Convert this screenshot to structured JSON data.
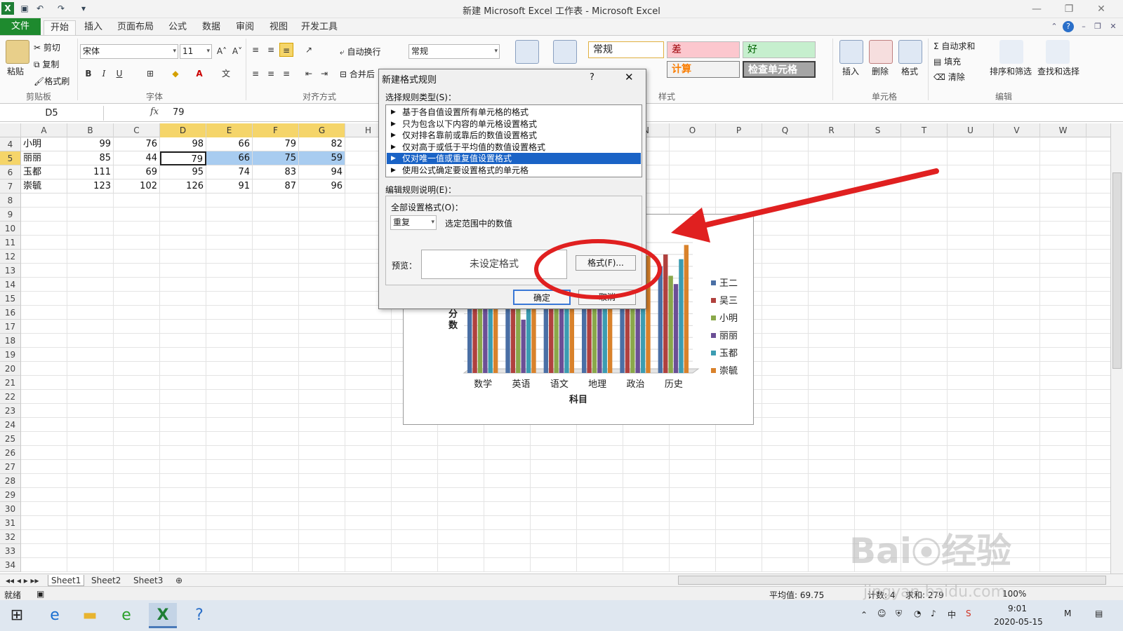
{
  "window": {
    "title": "新建 Microsoft Excel 工作表 - Microsoft Excel"
  },
  "tabs": [
    "文件",
    "开始",
    "插入",
    "页面布局",
    "公式",
    "数据",
    "审阅",
    "视图",
    "开发工具"
  ],
  "ribbon": {
    "clipboard": {
      "paste": "粘贴",
      "cut": "剪切",
      "copy": "复制",
      "format_painter": "格式刷",
      "label": "剪贴板"
    },
    "font": {
      "name": "宋体",
      "size": "11",
      "label": "字体",
      "bold": "B",
      "italic": "I",
      "underline": "U"
    },
    "alignment": {
      "wrap": "自动换行",
      "merge": "合并后",
      "label": "对齐方式"
    },
    "number": {
      "format": "常规"
    },
    "styles": {
      "normal": "常规",
      "bad": "差",
      "good": "好",
      "calc": "计算",
      "check": "检查单元格",
      "label": "样式"
    },
    "cells": {
      "insert": "插入",
      "delete": "删除",
      "format": "格式",
      "label": "单元格"
    },
    "editing": {
      "autosum": "自动求和",
      "fill": "填充",
      "clear": "清除",
      "sort": "排序和筛选",
      "find": "查找和选择",
      "label": "编辑"
    }
  },
  "formula_bar": {
    "name_box": "D5",
    "fx": "fx",
    "value": "79"
  },
  "columns": [
    "A",
    "B",
    "C",
    "D",
    "E",
    "F",
    "G",
    "H",
    "I",
    "J",
    "K",
    "L",
    "M",
    "N",
    "O",
    "P",
    "Q",
    "R",
    "S",
    "T",
    "U",
    "V",
    "W"
  ],
  "rows": [
    {
      "num": "4",
      "cells": [
        "小明",
        "99",
        "76",
        "98",
        "66",
        "79",
        "82"
      ]
    },
    {
      "num": "5",
      "cells": [
        "丽丽",
        "85",
        "44",
        "79",
        "66",
        "75",
        "59"
      ]
    },
    {
      "num": "6",
      "cells": [
        "玉都",
        "111",
        "69",
        "95",
        "74",
        "83",
        "94"
      ]
    },
    {
      "num": "7",
      "cells": [
        "崇毓",
        "123",
        "102",
        "126",
        "91",
        "87",
        "96"
      ]
    }
  ],
  "empty_rows": [
    "8",
    "9",
    "10",
    "11",
    "12",
    "13",
    "14",
    "15",
    "16",
    "17",
    "18",
    "19",
    "20",
    "21",
    "22",
    "23",
    "24",
    "25",
    "26",
    "27",
    "28",
    "29",
    "30",
    "31",
    "32",
    "33",
    "34"
  ],
  "chart_data": {
    "type": "bar",
    "xlabel": "科目",
    "ylabel": "分数",
    "categories": [
      "数学",
      "英语",
      "语文",
      "地理",
      "政治",
      "历史"
    ],
    "series": [
      {
        "name": "王二",
        "color": "#4a6fa5",
        "values": [
          95,
          85,
          92,
          70,
          70,
          90
        ]
      },
      {
        "name": "吴三",
        "color": "#b0413e",
        "values": [
          100,
          93,
          99,
          88,
          87,
          100
        ]
      },
      {
        "name": "小明",
        "color": "#8aa84a",
        "values": [
          95,
          78,
          98,
          68,
          84,
          82
        ]
      },
      {
        "name": "丽丽",
        "color": "#6b4f96",
        "values": [
          90,
          45,
          94,
          80,
          87,
          75
        ]
      },
      {
        "name": "玉都",
        "color": "#3b9cb2",
        "values": [
          98,
          70,
          93,
          85,
          90,
          96
        ]
      },
      {
        "name": "崇毓",
        "color": "#d9822b",
        "values": [
          106,
          101,
          109,
          99,
          99,
          108
        ]
      }
    ],
    "ylim": [
      0,
      110
    ]
  },
  "dialog": {
    "title": "新建格式规则",
    "help": "?",
    "close": "✕",
    "rule_type_label": "选择规则类型(S)：",
    "rule_types": [
      "基于各自值设置所有单元格的格式",
      "只为包含以下内容的单元格设置格式",
      "仅对排名靠前或靠后的数值设置格式",
      "仅对高于或低于平均值的数值设置格式",
      "仅对唯一值或重复值设置格式",
      "使用公式确定要设置格式的单元格"
    ],
    "selected_rule": 4,
    "edit_label": "编辑规则说明(E)：",
    "all_format_label": "全部设置格式(O)：",
    "dup_select": "重复",
    "dup_suffix": "选定范围中的数值",
    "preview_label": "预览：",
    "preview_text": "未设定格式",
    "format_button": "格式(F)...",
    "ok": "确定",
    "cancel": "取消"
  },
  "sheets": [
    "Sheet1",
    "Sheet2",
    "Sheet3"
  ],
  "status": {
    "ready": "就绪",
    "average": "平均值: 69.75",
    "count": "计数: 4",
    "sum": "求和: 279",
    "zoom": "100%"
  },
  "taskbar": {
    "time": "9:01",
    "date": "2020-05-15",
    "ime": "中"
  },
  "watermark": {
    "brand": "Bai",
    "brand2": "经验",
    "url": "jingyan.baidu.com"
  }
}
